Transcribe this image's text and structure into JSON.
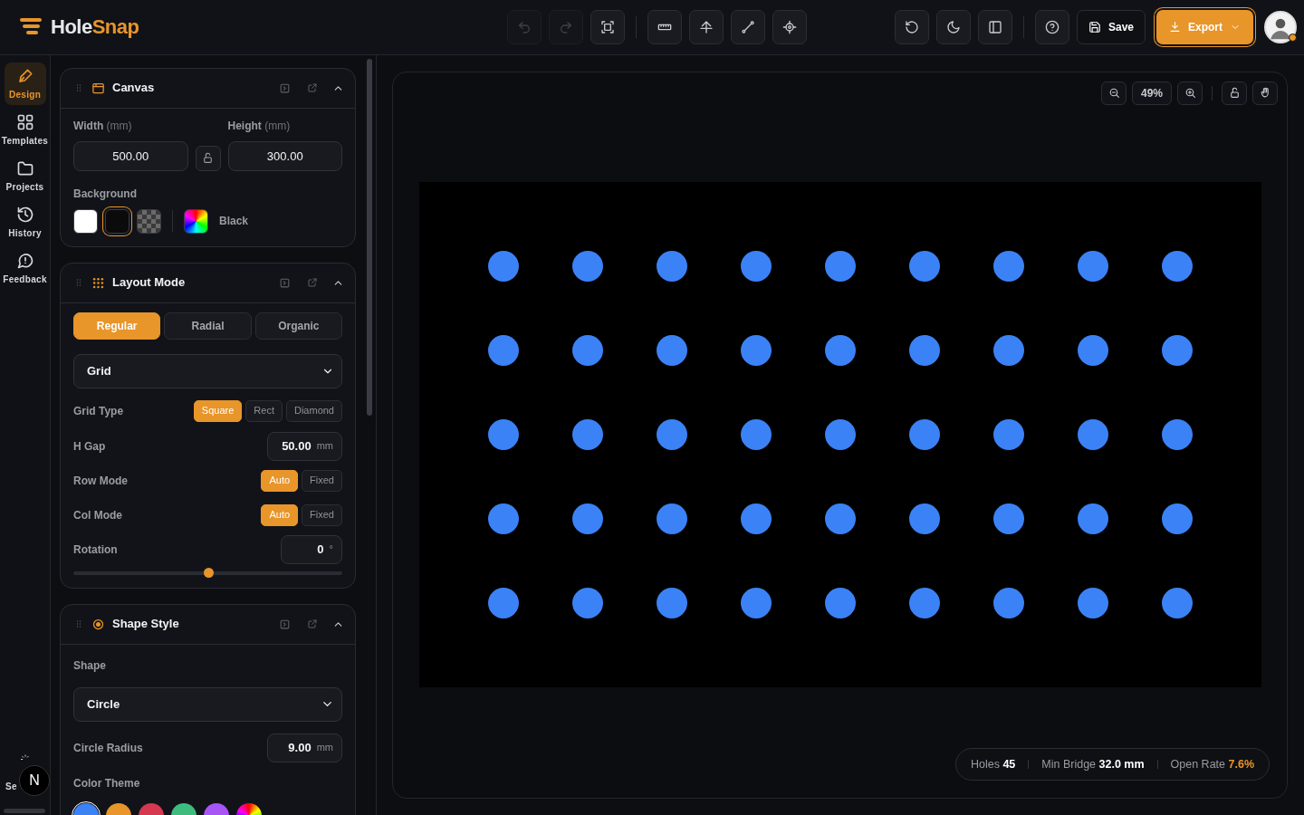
{
  "header": {
    "logo": {
      "first": "Hole",
      "second": "Snap"
    },
    "toolbar_groups": [
      [
        {
          "disabled": true
        },
        {
          "disabled": true
        },
        {
          "disabled": false
        }
      ],
      [
        {
          "disabled": false
        },
        {
          "disabled": false
        },
        {
          "disabled": false
        },
        {
          "disabled": false
        }
      ]
    ],
    "right_tools": [
      {
        "disabled": false
      },
      {
        "disabled": false
      },
      {
        "disabled": false
      },
      {
        "disabled": false
      }
    ],
    "save": "Save",
    "export": "Export",
    "avatar": {
      "online": true
    }
  },
  "rail": {
    "items": [
      {
        "label": "Design",
        "selected": true
      },
      {
        "label": "Templates",
        "selected": false
      },
      {
        "label": "Projects",
        "selected": false
      },
      {
        "label": "History",
        "selected": false
      },
      {
        "label": "Feedback",
        "selected": false
      }
    ],
    "bottom_item": {
      "label": "Se"
    },
    "dev_badge": "N"
  },
  "canvas_panel": {
    "title": "Canvas",
    "width": {
      "label": "Width",
      "unit": "(mm)",
      "value": "500.00"
    },
    "height": {
      "label": "Height",
      "unit": "(mm)",
      "value": "300.00"
    },
    "ratio_locked": false,
    "background": {
      "label": "Background",
      "swatches": [
        {
          "kind": "white",
          "selected": false
        },
        {
          "kind": "black",
          "selected": true
        },
        {
          "kind": "transparent",
          "selected": false
        },
        {
          "kind": "custom",
          "selected": false
        }
      ],
      "current": "Black"
    }
  },
  "layout_panel": {
    "title": "Layout Mode",
    "modes": [
      {
        "label": "Regular",
        "selected": true
      },
      {
        "label": "Radial",
        "selected": false
      },
      {
        "label": "Organic",
        "selected": false
      }
    ],
    "pattern": "Grid",
    "grid_type": {
      "label": "Grid Type",
      "options": [
        {
          "label": "Square",
          "selected": true
        },
        {
          "label": "Rect",
          "selected": false
        },
        {
          "label": "Diamond",
          "selected": false
        }
      ]
    },
    "h_gap": {
      "label": "H Gap",
      "value": "50.00",
      "unit": "mm"
    },
    "row_mode": {
      "label": "Row Mode",
      "options": [
        {
          "label": "Auto",
          "selected": true
        },
        {
          "label": "Fixed",
          "selected": false
        }
      ]
    },
    "col_mode": {
      "label": "Col Mode",
      "options": [
        {
          "label": "Auto",
          "selected": true
        },
        {
          "label": "Fixed",
          "selected": false
        }
      ]
    },
    "rotation": {
      "label": "Rotation",
      "value": "0",
      "unit": "°",
      "level": 0.5
    }
  },
  "shape_panel": {
    "title": "Shape Style",
    "shape_label": "Shape",
    "shape": "Circle",
    "radius": {
      "label": "Circle Radius",
      "value": "9.00",
      "unit": "mm"
    },
    "theme_label": "Color Theme",
    "themes": [
      {
        "kind": "solid",
        "color": "#3b82f6",
        "selected": true
      },
      {
        "kind": "solid",
        "color": "#e8952a",
        "selected": false
      },
      {
        "kind": "solid",
        "color": "#d63850",
        "selected": false
      },
      {
        "kind": "solid",
        "color": "#3dbd7d",
        "selected": false
      },
      {
        "kind": "solid",
        "color": "#a855f7",
        "selected": false
      },
      {
        "kind": "multi",
        "selected": false
      }
    ]
  },
  "viewport": {
    "zoom": "49%",
    "locked": false
  },
  "stats": [
    {
      "label": "Holes",
      "value": "45",
      "accent": false
    },
    {
      "label": "Min Bridge",
      "value": "32.0 mm",
      "accent": false
    },
    {
      "label": "Open Rate",
      "value": "7.6%",
      "accent": true
    }
  ]
}
